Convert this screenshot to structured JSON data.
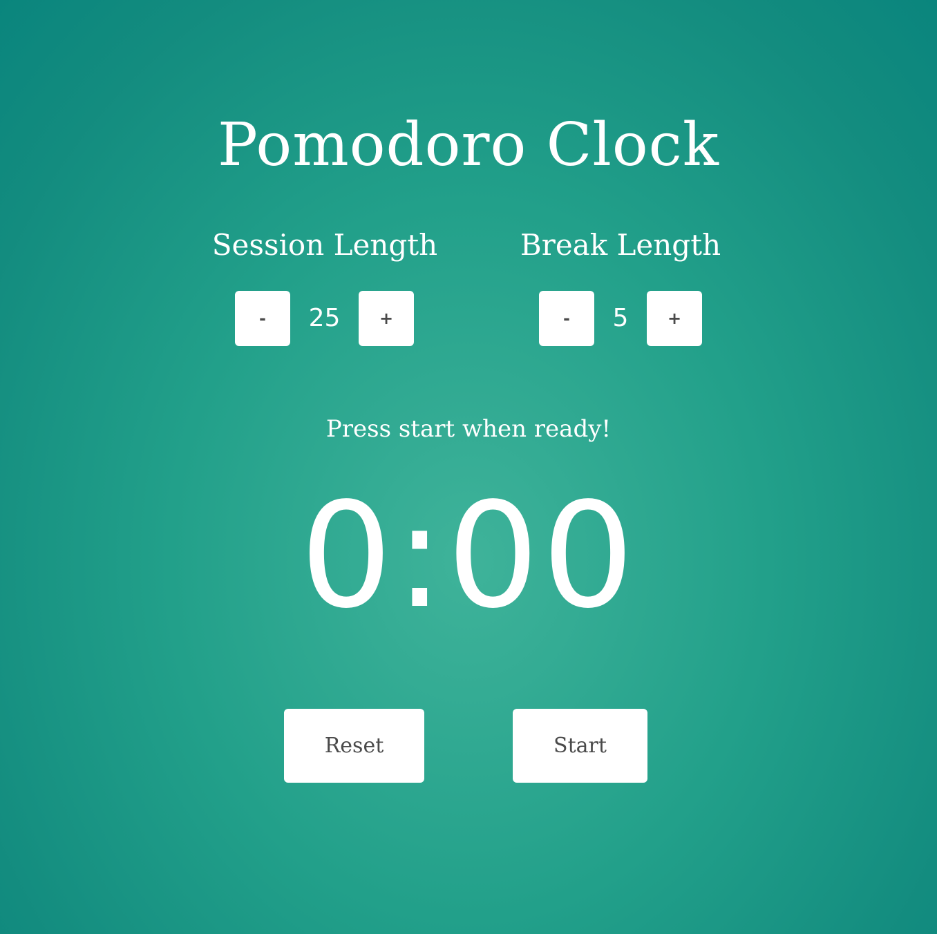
{
  "app": {
    "title": "Pomodoro Clock"
  },
  "session": {
    "label": "Session Length",
    "decrement_label": "-",
    "value": "25",
    "increment_label": "+"
  },
  "break": {
    "label": "Break Length",
    "decrement_label": "-",
    "value": "5",
    "increment_label": "+"
  },
  "status": {
    "message": "Press start when ready!"
  },
  "timer": {
    "display": "0:00"
  },
  "actions": {
    "reset_label": "Reset",
    "start_label": "Start"
  },
  "colors": {
    "background": "#149282",
    "card": "#78c8b4",
    "button": "#ffffff",
    "button_text": "#4a4a4a",
    "text": "#ffffff"
  }
}
